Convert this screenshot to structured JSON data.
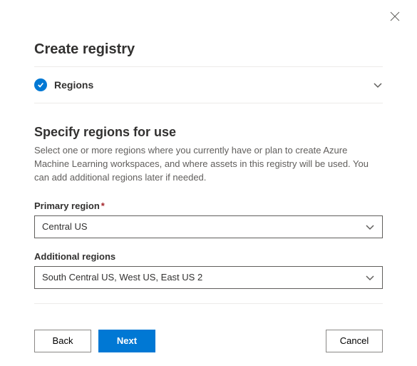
{
  "header": {
    "title": "Create registry"
  },
  "section": {
    "label": "Regions",
    "subtitle": "Specify regions for use",
    "description": "Select one or more regions where you currently have or plan to create Azure Machine Learning workspaces, and where assets in this registry will be used. You can add additional regions later if needed."
  },
  "fields": {
    "primary": {
      "label": "Primary region",
      "required_mark": "*",
      "value": "Central US"
    },
    "additional": {
      "label": "Additional regions",
      "value": "South Central US, West US, East US 2"
    }
  },
  "footer": {
    "back": "Back",
    "next": "Next",
    "cancel": "Cancel"
  }
}
